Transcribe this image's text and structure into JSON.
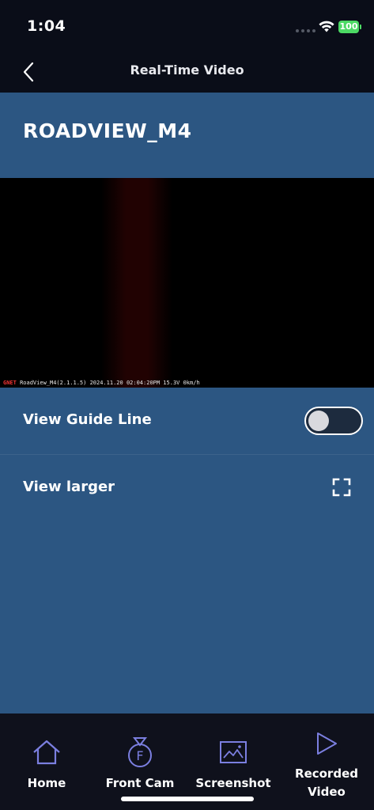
{
  "status_bar": {
    "time": "1:04",
    "battery": "100"
  },
  "nav": {
    "title": "Real-Time Video"
  },
  "device": {
    "name": "ROADVIEW_M4"
  },
  "video": {
    "overlay_text": "RoadView_M4(2.1.1.5) 2024.11.20 02:04:20PM 15.3V   0km/h",
    "logo": "GNET"
  },
  "settings": {
    "guide_line_label": "View Guide Line",
    "guide_line_on": false,
    "view_larger_label": "View larger"
  },
  "tabs": [
    {
      "label": "Home",
      "icon": "home-icon"
    },
    {
      "label": "Front Cam",
      "icon": "front-cam-icon"
    },
    {
      "label": "Screenshot",
      "icon": "screenshot-icon"
    },
    {
      "label": "Recorded Video",
      "label_line1": "Recorded",
      "label_line2": "Video",
      "icon": "play-icon"
    }
  ],
  "colors": {
    "accent": "#7b7fe0",
    "background": "#2c5682",
    "bar": "#0a0d18"
  }
}
